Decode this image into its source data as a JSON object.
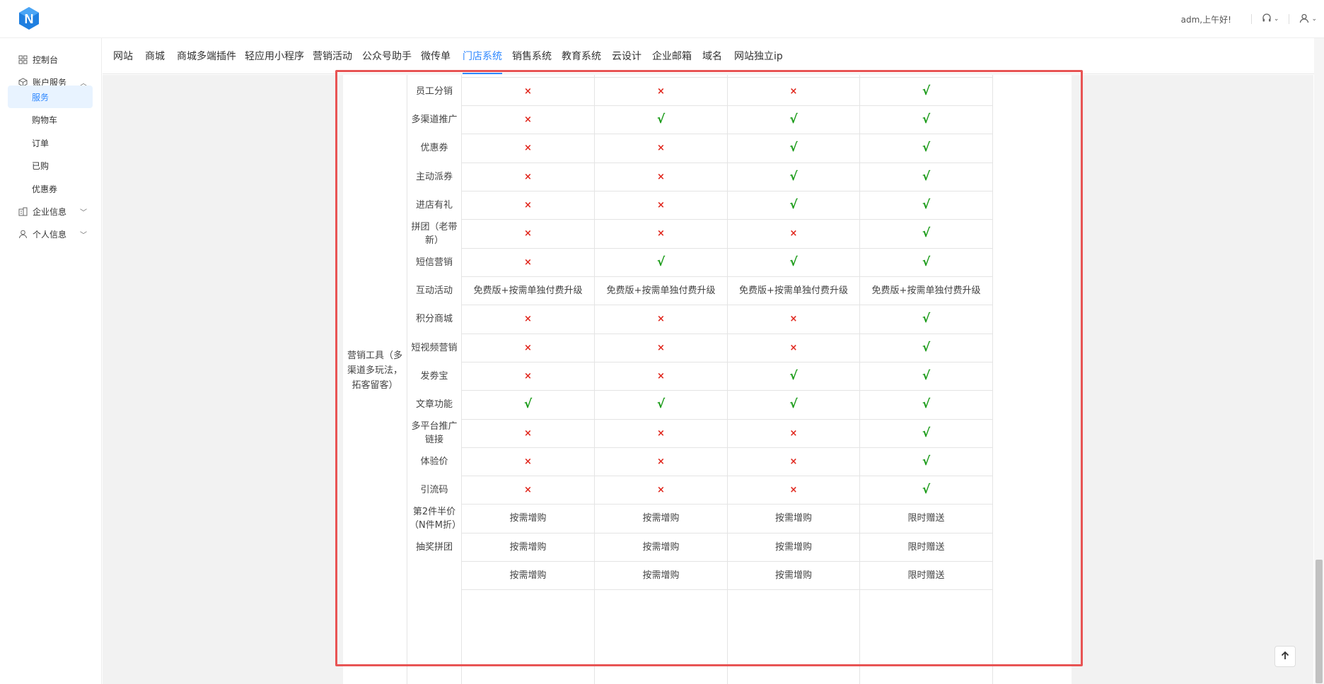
{
  "header": {
    "greeting": "adm,上午好!",
    "support_icon": "headset-icon",
    "user_icon": "user-icon"
  },
  "sidebar": {
    "dashboard": "控制台",
    "account_services": "账户服务",
    "services": "服务",
    "cart": "购物车",
    "orders": "订单",
    "purchased": "已购",
    "coupons": "优惠券",
    "company_info": "企业信息",
    "personal_info": "个人信息"
  },
  "tabs": [
    "网站",
    "商城",
    "商城多端插件",
    "轻应用小程序",
    "营销活动",
    "公众号助手",
    "微传单",
    "门店系统",
    "销售系统",
    "教育系统",
    "云设计",
    "企业邮箱",
    "域名",
    "网站独立ip"
  ],
  "active_tab": "门店系统",
  "table": {
    "category": "营销工具（多渠道多玩法，拓客留客）",
    "rows": [
      {
        "feature": "",
        "values": [
          "×",
          "×",
          "×",
          "√"
        ]
      },
      {
        "feature": "员工分销",
        "values": [
          "×",
          "×",
          "×",
          "√"
        ]
      },
      {
        "feature": "多渠道推广",
        "values": [
          "×",
          "√",
          "√",
          "√"
        ]
      },
      {
        "feature": "优惠券",
        "values": [
          "×",
          "×",
          "√",
          "√"
        ]
      },
      {
        "feature": "主动派券",
        "values": [
          "×",
          "×",
          "√",
          "√"
        ]
      },
      {
        "feature": "进店有礼",
        "values": [
          "×",
          "×",
          "√",
          "√"
        ]
      },
      {
        "feature": "拼团（老带新）",
        "values": [
          "×",
          "×",
          "×",
          "√"
        ]
      },
      {
        "feature": "短信营销",
        "values": [
          "×",
          "√",
          "√",
          "√"
        ]
      },
      {
        "feature": "互动活动",
        "values": [
          "免费版+按需单独付费升级",
          "免费版+按需单独付费升级",
          "免费版+按需单独付费升级",
          "免费版+按需单独付费升级"
        ]
      },
      {
        "feature": "积分商城",
        "values": [
          "×",
          "×",
          "×",
          "√"
        ]
      },
      {
        "feature": "短视频营销",
        "values": [
          "×",
          "×",
          "×",
          "√"
        ]
      },
      {
        "feature": "发劵宝",
        "values": [
          "×",
          "×",
          "√",
          "√"
        ]
      },
      {
        "feature": "文章功能",
        "values": [
          "√",
          "√",
          "√",
          "√"
        ]
      },
      {
        "feature": "多平台推广链接",
        "values": [
          "×",
          "×",
          "×",
          "√"
        ]
      },
      {
        "feature": "体验价",
        "values": [
          "×",
          "×",
          "×",
          "√"
        ]
      },
      {
        "feature": "引流码",
        "values": [
          "×",
          "×",
          "×",
          "√"
        ]
      },
      {
        "feature": "第2件半价（N件M折）",
        "values": [
          "按需增购",
          "按需增购",
          "按需增购",
          "限时赠送"
        ]
      },
      {
        "feature": "抽奖拼团",
        "values": [
          "按需增购",
          "按需增购",
          "按需增购",
          "限时赠送"
        ]
      },
      {
        "feature": "",
        "values": [
          "按需增购",
          "按需增购",
          "按需增购",
          "限时赠送"
        ]
      }
    ]
  },
  "back_to_top_icon": "arrow-up-icon"
}
